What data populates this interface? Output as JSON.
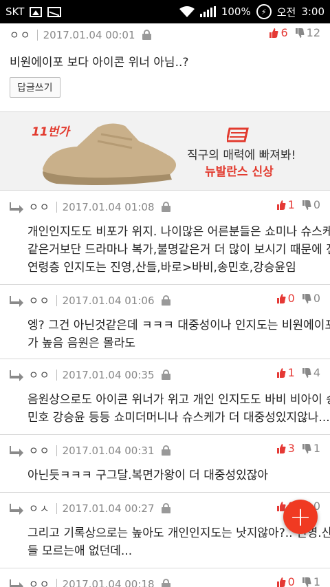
{
  "status_bar": {
    "carrier": "SKT",
    "battery": "100%",
    "time_label": "오전",
    "time": "3:00"
  },
  "top_comment": {
    "author": "ㅇㅇ",
    "date": "2017.01.04 00:01",
    "up": "6",
    "down": "12",
    "text": "비원에이포 보다 아이콘 위너 아님..?",
    "reply_button": "답글쓰기"
  },
  "ad": {
    "brand_11st": "11번가",
    "line1": "직구의 매력에 빠져봐!",
    "line2": "뉴발란스 신상"
  },
  "replies": [
    {
      "author": "ㅇㅇ",
      "date": "2017.01.04 01:08",
      "up": "1",
      "down": "0",
      "lines": [
        "개인인지도도 비포가 위지. 나이많은 어른분들은 쇼미나 슈스케",
        "같은거보단 드라마나 복가,불명같은거 더 많이 보시기 때문에 전",
        "연령층 인지도는 진영,산들,바로>바비,송민호,강승윤임"
      ]
    },
    {
      "author": "ㅇㅇ",
      "date": "2017.01.04 01:06",
      "up": "0",
      "down": "0",
      "lines": [
        "엥? 그건 아닌것같은데 ㅋㅋㅋ 대중성이나 인지도는 비원에이포",
        "가 높음 음원은 몰라도"
      ]
    },
    {
      "author": "ㅇㅇ",
      "date": "2017.01.04 00:35",
      "up": "1",
      "down": "4",
      "lines": [
        "음원상으로도 아이콘 위너가 위고 개인 인지도도 바비 비아이 송",
        "민호 강승윤 등등 쇼미더머니나 슈스케가 더 대중성있지않나....?"
      ]
    },
    {
      "author": "ㅇㅇ",
      "date": "2017.01.04 00:31",
      "up": "3",
      "down": "1",
      "lines": [
        "아닌듯ㅋㅋㅋ 구그달.복면가왕이 더 대중성있잖아"
      ]
    },
    {
      "author": "ㅇㅅ",
      "date": "2017.01.04 00:27",
      "up": "0",
      "down": "0",
      "lines": [
        "그리고 기록상으로는 높아도 개인인지도는 낫지않아?.. 진영.산",
        "들 모르는애 없던데..."
      ]
    },
    {
      "author": "ㅇㅇ",
      "date": "2017.01.04 00:18",
      "up": "0",
      "down": "1",
      "lines": []
    }
  ],
  "fab": {
    "label": "+"
  },
  "colors": {
    "accent": "#f03a22",
    "vote_up": "#e53935",
    "vote_down": "#888888",
    "divider": "#d8d8d8"
  }
}
